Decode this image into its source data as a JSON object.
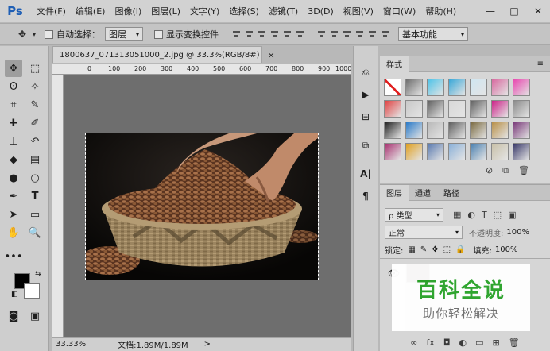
{
  "app": {
    "logo": "Ps",
    "menus": [
      "文件(F)",
      "编辑(E)",
      "图像(I)",
      "图层(L)",
      "文字(Y)",
      "选择(S)",
      "滤镜(T)",
      "3D(D)",
      "视图(V)",
      "窗口(W)",
      "帮助(H)"
    ],
    "window_controls": [
      "—",
      "□",
      "✕"
    ]
  },
  "options": {
    "auto_select_label": "自动选择：",
    "auto_select_value": "图层",
    "show_transform_label": "显示变换控件",
    "workspace": "基本功能"
  },
  "document": {
    "tab_title": "1800637_071313051000_2.jpg @ 33.3%(RGB/8#)",
    "close": "×",
    "ruler_ticks": [
      "0",
      "100",
      "200",
      "300",
      "400",
      "500",
      "600",
      "700",
      "800",
      "900",
      "1000"
    ],
    "zoom": "33.33%",
    "doc_info": "文档:1.89M/1.89M",
    "status_arrow": ">"
  },
  "styles_panel": {
    "tab": "样式",
    "menu": "≡",
    "swatches": [
      "#ffffff",
      "#6e6e6e",
      "#4ec3e8",
      "#3aa8d8",
      "#cfe6f2",
      "#d86aa0",
      "#e84ab0",
      "#e04040",
      "#c8c8c8",
      "#606060",
      "#d8d8d8",
      "#606060",
      "#cc2288",
      "#8a8a8a",
      "#202020",
      "#2a7ac8",
      "#b8b8b8",
      "#606060",
      "#7a6a40",
      "#b89048",
      "#7a3a7a",
      "#a83070",
      "#e0a020",
      "#5a7ab0",
      "#8ab0d8",
      "#4a80b0",
      "#c8c0a8",
      "#3a3a6a"
    ]
  },
  "layers_panel": {
    "tabs": [
      "图层",
      "通道",
      "路径"
    ],
    "filter": "ρ 类型",
    "blend_mode": "正常",
    "opacity_label": "不透明度:",
    "opacity_value": "100%",
    "lock_label": "锁定:",
    "fill_label": "填充:",
    "fill_value": "100%",
    "footer_icons": [
      "∞",
      "fx",
      "◘",
      "◐",
      "▭",
      "⊞",
      "🗑"
    ]
  },
  "watermark": {
    "title": "百科全说",
    "subtitle": "助你轻松解决"
  }
}
